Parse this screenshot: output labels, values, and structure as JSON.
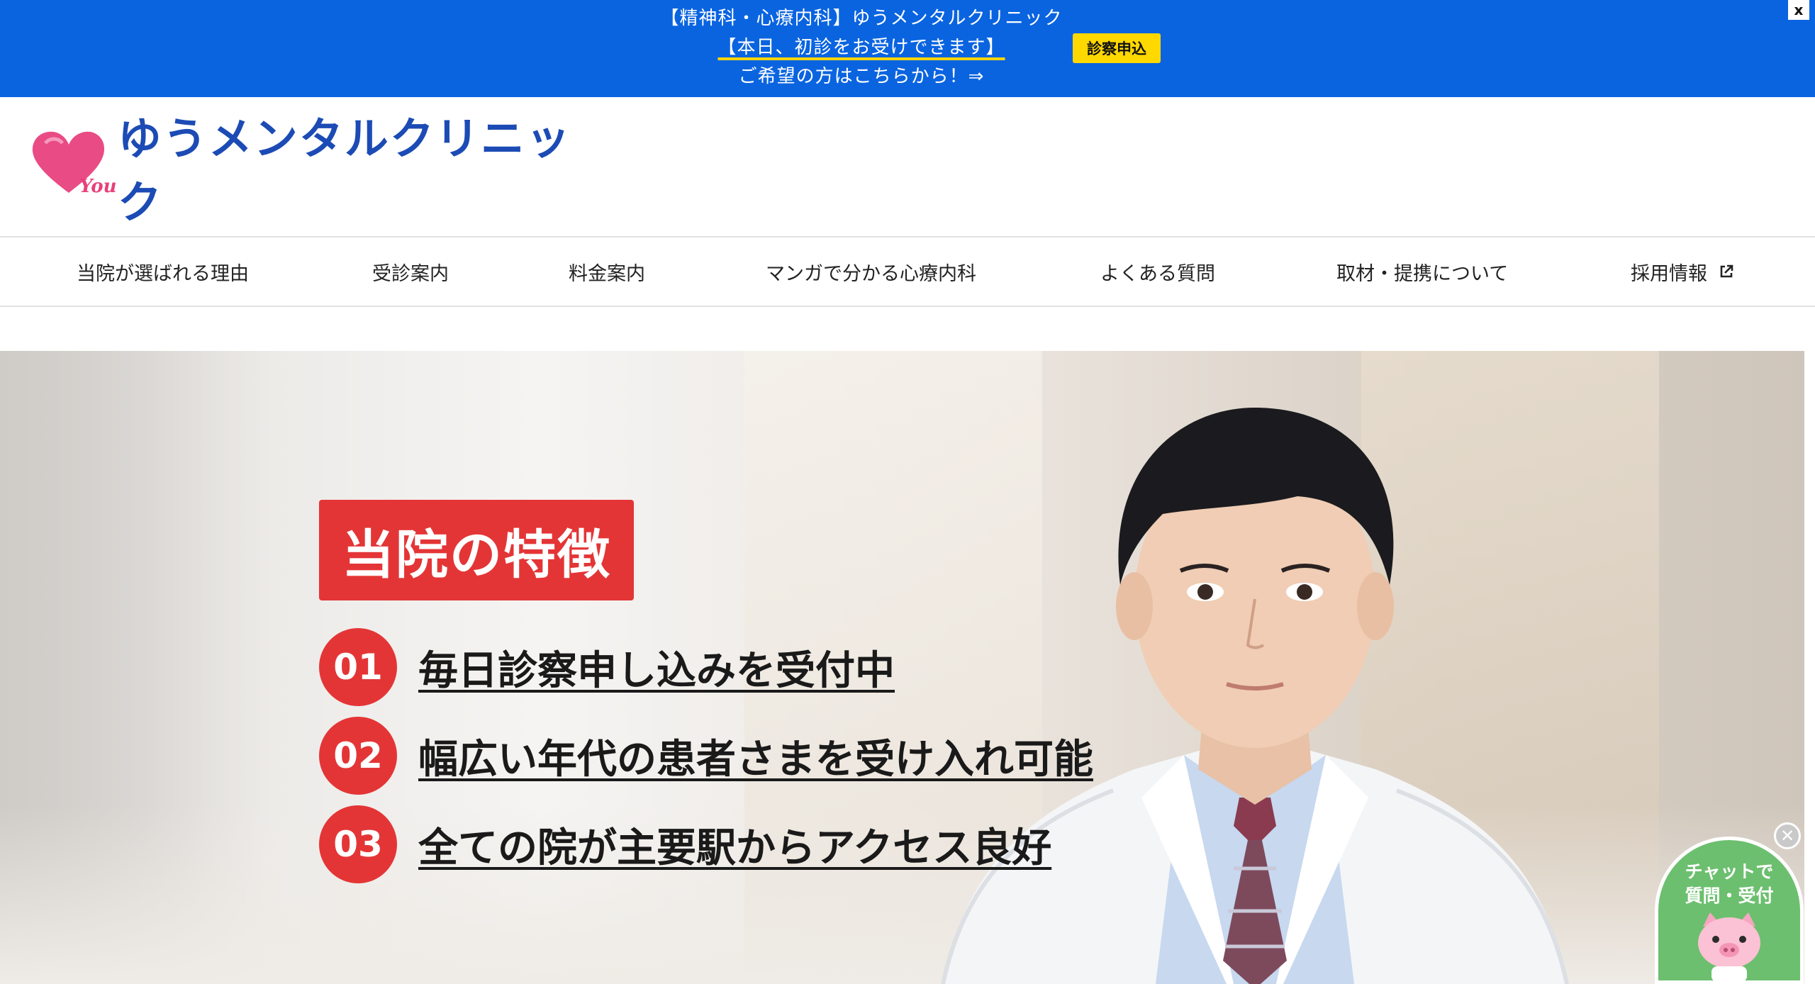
{
  "banner": {
    "line1": "【精神科・心療内科】ゆうメンタルクリニック",
    "line2": "【本日、初診をお受けできます】",
    "line3": "ご希望の方はこちらから！⇒",
    "button_label": "診察申込",
    "close_label": "x",
    "bg_color": "#0a64e0",
    "button_color": "#ffd800"
  },
  "logo": {
    "text": "ゆうメンタルクリニック",
    "mark_text": "You",
    "icon": "heart-icon"
  },
  "nav": {
    "items": [
      {
        "label": "当院が選ばれる理由"
      },
      {
        "label": "受診案内"
      },
      {
        "label": "料金案内"
      },
      {
        "label": "マンガで分かる心療内科"
      },
      {
        "label": "よくある質問"
      },
      {
        "label": "取材・提携について"
      },
      {
        "label": "採用情報",
        "icon": "external-link-icon"
      }
    ]
  },
  "hero": {
    "title": "当院の特徴",
    "accent_color": "#e43536",
    "features": [
      {
        "num": "01",
        "text": "毎日診察申し込みを受付中"
      },
      {
        "num": "02",
        "text": "幅広い年代の患者さまを受け入れ可能"
      },
      {
        "num": "03",
        "text": "全ての院が主要駅からアクセス良好"
      }
    ]
  },
  "chat": {
    "line1": "チャットで",
    "line2": "質問・受付",
    "close_label": "✕",
    "color": "#6cbf6e",
    "icon": "pig-mascot-icon"
  }
}
